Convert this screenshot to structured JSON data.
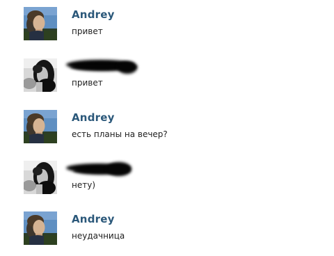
{
  "conversation": {
    "messages": [
      {
        "author": "Andrey",
        "author_visible": true,
        "avatar_icon": "young-man-avatar-icon",
        "text": "привет"
      },
      {
        "author": "",
        "author_visible": false,
        "avatar_icon": "dark-haired-woman-avatar-icon",
        "text": "привет"
      },
      {
        "author": "Andrey",
        "author_visible": true,
        "avatar_icon": "young-man-avatar-icon",
        "text": "есть планы на вечер?"
      },
      {
        "author": "",
        "author_visible": false,
        "avatar_icon": "dark-haired-woman-avatar-icon",
        "text": "нету)"
      },
      {
        "author": "Andrey",
        "author_visible": true,
        "avatar_icon": "young-man-avatar-icon",
        "text": "неудачница"
      }
    ]
  },
  "colors": {
    "background": "#ffffff",
    "author_name": "#2b587a",
    "message_text": "#1e1e1e",
    "redaction": "#050505"
  }
}
